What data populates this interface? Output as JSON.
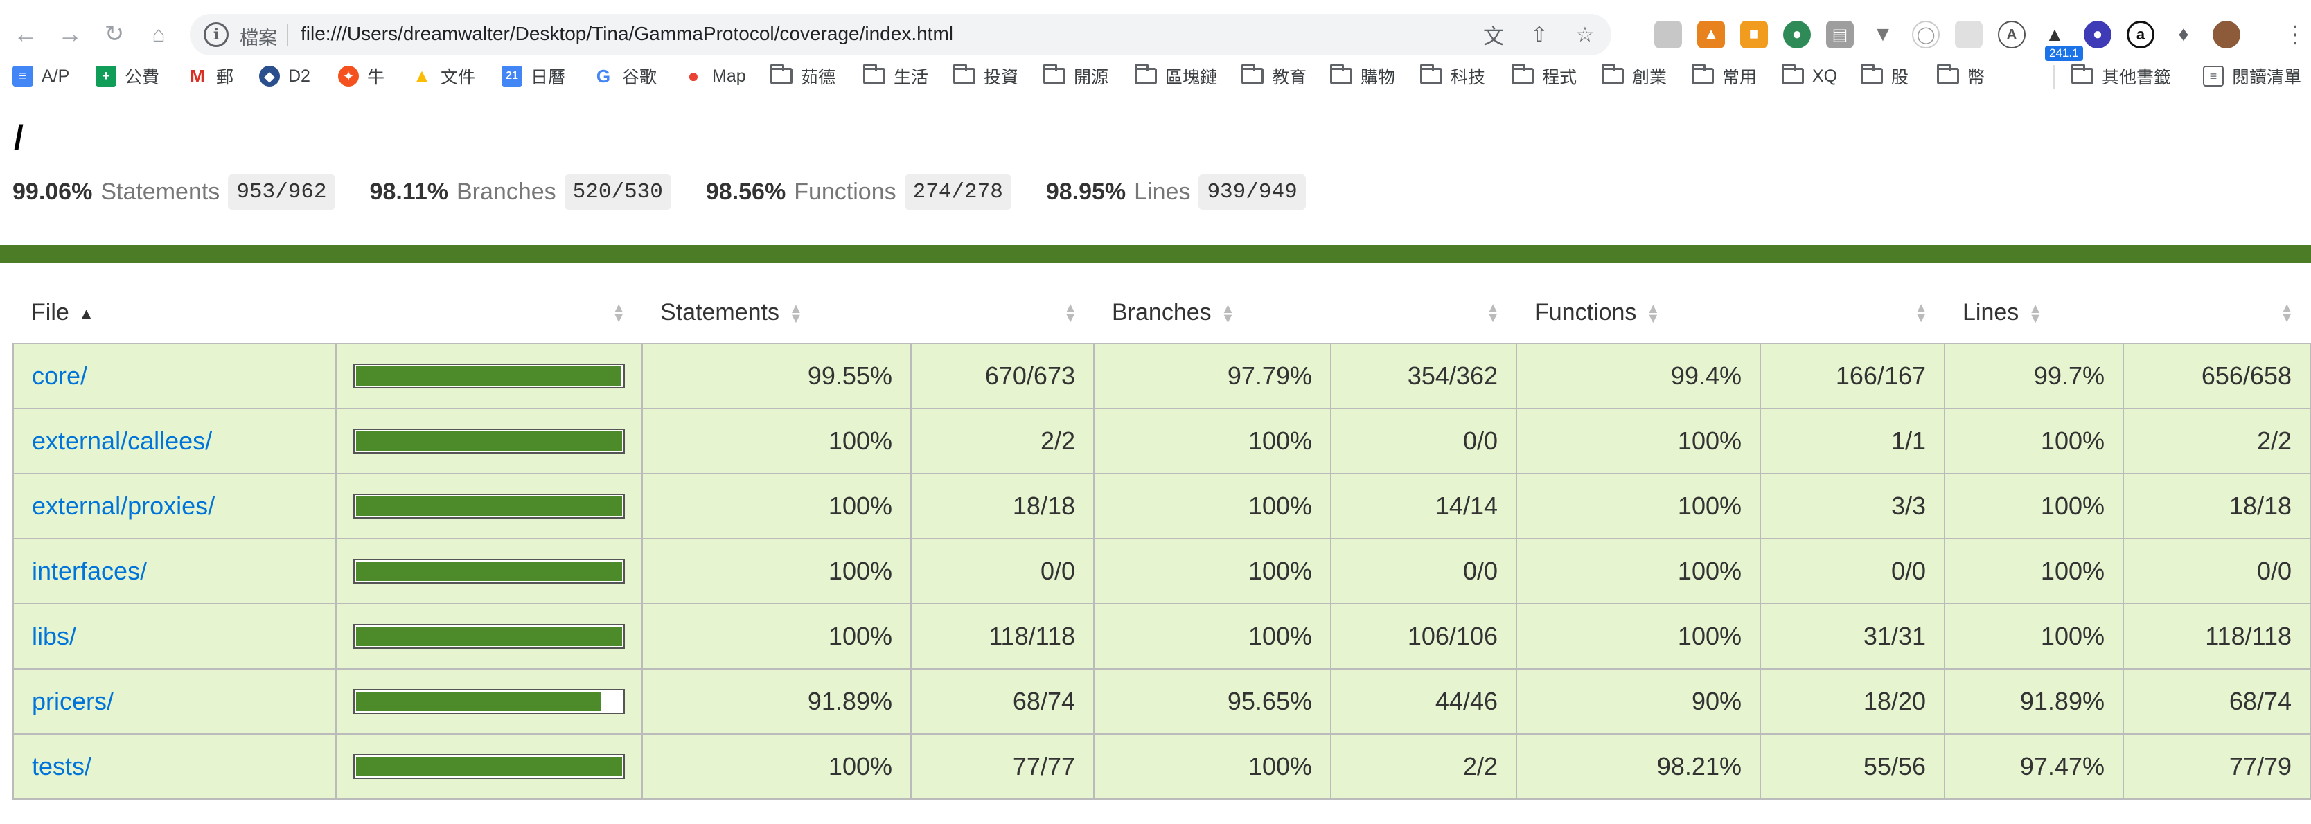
{
  "browser": {
    "scheme_label": "檔案",
    "url": "file:///Users/dreamwalter/Desktop/Tina/GammaProtocol/coverage/index.html",
    "ext_badge": "241.1",
    "bookmarks": [
      {
        "label": "A/P",
        "icon": "doc-icon"
      },
      {
        "label": "公費",
        "icon": "sheet-icon"
      },
      {
        "label": "郵",
        "icon": "gmail-icon"
      },
      {
        "label": "D2",
        "icon": "d2-icon"
      },
      {
        "label": "牛",
        "icon": "bull-icon"
      },
      {
        "label": "文件",
        "icon": "drive-icon"
      },
      {
        "label": "日曆",
        "icon": "calendar-icon"
      },
      {
        "label": "谷歌",
        "icon": "google-icon"
      },
      {
        "label": "Map",
        "icon": "maps-icon"
      },
      {
        "label": "茹德",
        "icon": "folder-icon"
      },
      {
        "label": "生活",
        "icon": "folder-icon"
      },
      {
        "label": "投資",
        "icon": "folder-icon"
      },
      {
        "label": "開源",
        "icon": "folder-icon"
      },
      {
        "label": "區塊鏈",
        "icon": "folder-icon"
      },
      {
        "label": "教育",
        "icon": "folder-icon"
      },
      {
        "label": "購物",
        "icon": "folder-icon"
      },
      {
        "label": "科技",
        "icon": "folder-icon"
      },
      {
        "label": "程式",
        "icon": "folder-icon"
      },
      {
        "label": "創業",
        "icon": "folder-icon"
      },
      {
        "label": "常用",
        "icon": "folder-icon"
      },
      {
        "label": "XQ",
        "icon": "folder-icon"
      },
      {
        "label": "股",
        "icon": "folder-icon"
      },
      {
        "label": "幣",
        "icon": "folder-icon"
      }
    ],
    "other_bookmarks": "其他書籤",
    "reading_list": "閱讀清單"
  },
  "page": {
    "title": "/",
    "summary": [
      {
        "pct": "99.06%",
        "label": "Statements",
        "frac": "953/962"
      },
      {
        "pct": "98.11%",
        "label": "Branches",
        "frac": "520/530"
      },
      {
        "pct": "98.56%",
        "label": "Functions",
        "frac": "274/278"
      },
      {
        "pct": "98.95%",
        "label": "Lines",
        "frac": "939/949"
      }
    ],
    "status_color": "#4d7c26"
  },
  "table": {
    "headers": {
      "file": "File",
      "statements": "Statements",
      "branches": "Branches",
      "functions": "Functions",
      "lines": "Lines"
    },
    "rows": [
      {
        "file": "core/",
        "coverage": 0.9955,
        "s_pct": "99.55%",
        "s_abs": "670/673",
        "b_pct": "97.79%",
        "b_abs": "354/362",
        "f_pct": "99.4%",
        "f_abs": "166/167",
        "l_pct": "99.7%",
        "l_abs": "656/658"
      },
      {
        "file": "external/callees/",
        "coverage": 1.0,
        "s_pct": "100%",
        "s_abs": "2/2",
        "b_pct": "100%",
        "b_abs": "0/0",
        "f_pct": "100%",
        "f_abs": "1/1",
        "l_pct": "100%",
        "l_abs": "2/2"
      },
      {
        "file": "external/proxies/",
        "coverage": 1.0,
        "s_pct": "100%",
        "s_abs": "18/18",
        "b_pct": "100%",
        "b_abs": "14/14",
        "f_pct": "100%",
        "f_abs": "3/3",
        "l_pct": "100%",
        "l_abs": "18/18"
      },
      {
        "file": "interfaces/",
        "coverage": 1.0,
        "s_pct": "100%",
        "s_abs": "0/0",
        "b_pct": "100%",
        "b_abs": "0/0",
        "f_pct": "100%",
        "f_abs": "0/0",
        "l_pct": "100%",
        "l_abs": "0/0"
      },
      {
        "file": "libs/",
        "coverage": 1.0,
        "s_pct": "100%",
        "s_abs": "118/118",
        "b_pct": "100%",
        "b_abs": "106/106",
        "f_pct": "100%",
        "f_abs": "31/31",
        "l_pct": "100%",
        "l_abs": "118/118"
      },
      {
        "file": "pricers/",
        "coverage": 0.9189,
        "s_pct": "91.89%",
        "s_abs": "68/74",
        "b_pct": "95.65%",
        "b_abs": "44/46",
        "f_pct": "90%",
        "f_abs": "18/20",
        "l_pct": "91.89%",
        "l_abs": "68/74"
      },
      {
        "file": "tests/",
        "coverage": 1.0,
        "s_pct": "100%",
        "s_abs": "77/77",
        "b_pct": "100%",
        "b_abs": "2/2",
        "f_pct": "98.21%",
        "f_abs": "55/56",
        "l_pct": "97.47%",
        "l_abs": "77/79"
      }
    ]
  }
}
